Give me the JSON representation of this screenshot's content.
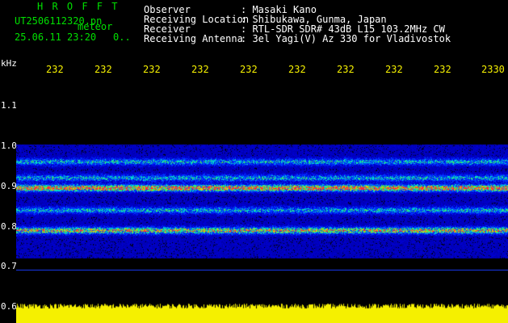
{
  "header": {
    "app_title": "H R O F F T",
    "filename": "UT2506112320.pn",
    "mode": "meteor",
    "datetime": "25.06.11 23:20",
    "count": "0.."
  },
  "station": [
    {
      "label": "Observer",
      "value": ": Masaki Kano"
    },
    {
      "label": "Receiving Location",
      "value": ": Shibukawa, Gunma, Japan"
    },
    {
      "label": "Receiver",
      "value": ": RTL-SDR SDR# 43dB L15 103.2MHz CW"
    },
    {
      "label": "Receiving Antenna",
      "value": ": 3el Yagi(V) Az 330 for Vladivostok"
    }
  ],
  "axis": {
    "y_unit": "kHz",
    "y_ticks": [
      "1.1",
      "1.0",
      "0.9",
      "0.8",
      "0.7",
      "0.6"
    ],
    "x_ticks": [
      "232",
      "232",
      "232",
      "232",
      "232",
      "232",
      "232",
      "232",
      "232",
      "2330"
    ]
  },
  "colors": {
    "header_title": "#00e000",
    "text": "#ffffff",
    "tick": "#f5f000",
    "background": "#000000",
    "signal_floor": "#f5f000"
  },
  "spectrogram": {
    "freq_range_khz": [
      0.6,
      1.2
    ],
    "noise_bands_khz": [
      0.935,
      0.83,
      0.88,
      0.96,
      1.0
    ],
    "band_upper_khz": 1.04,
    "band_lower_khz": 0.76
  }
}
